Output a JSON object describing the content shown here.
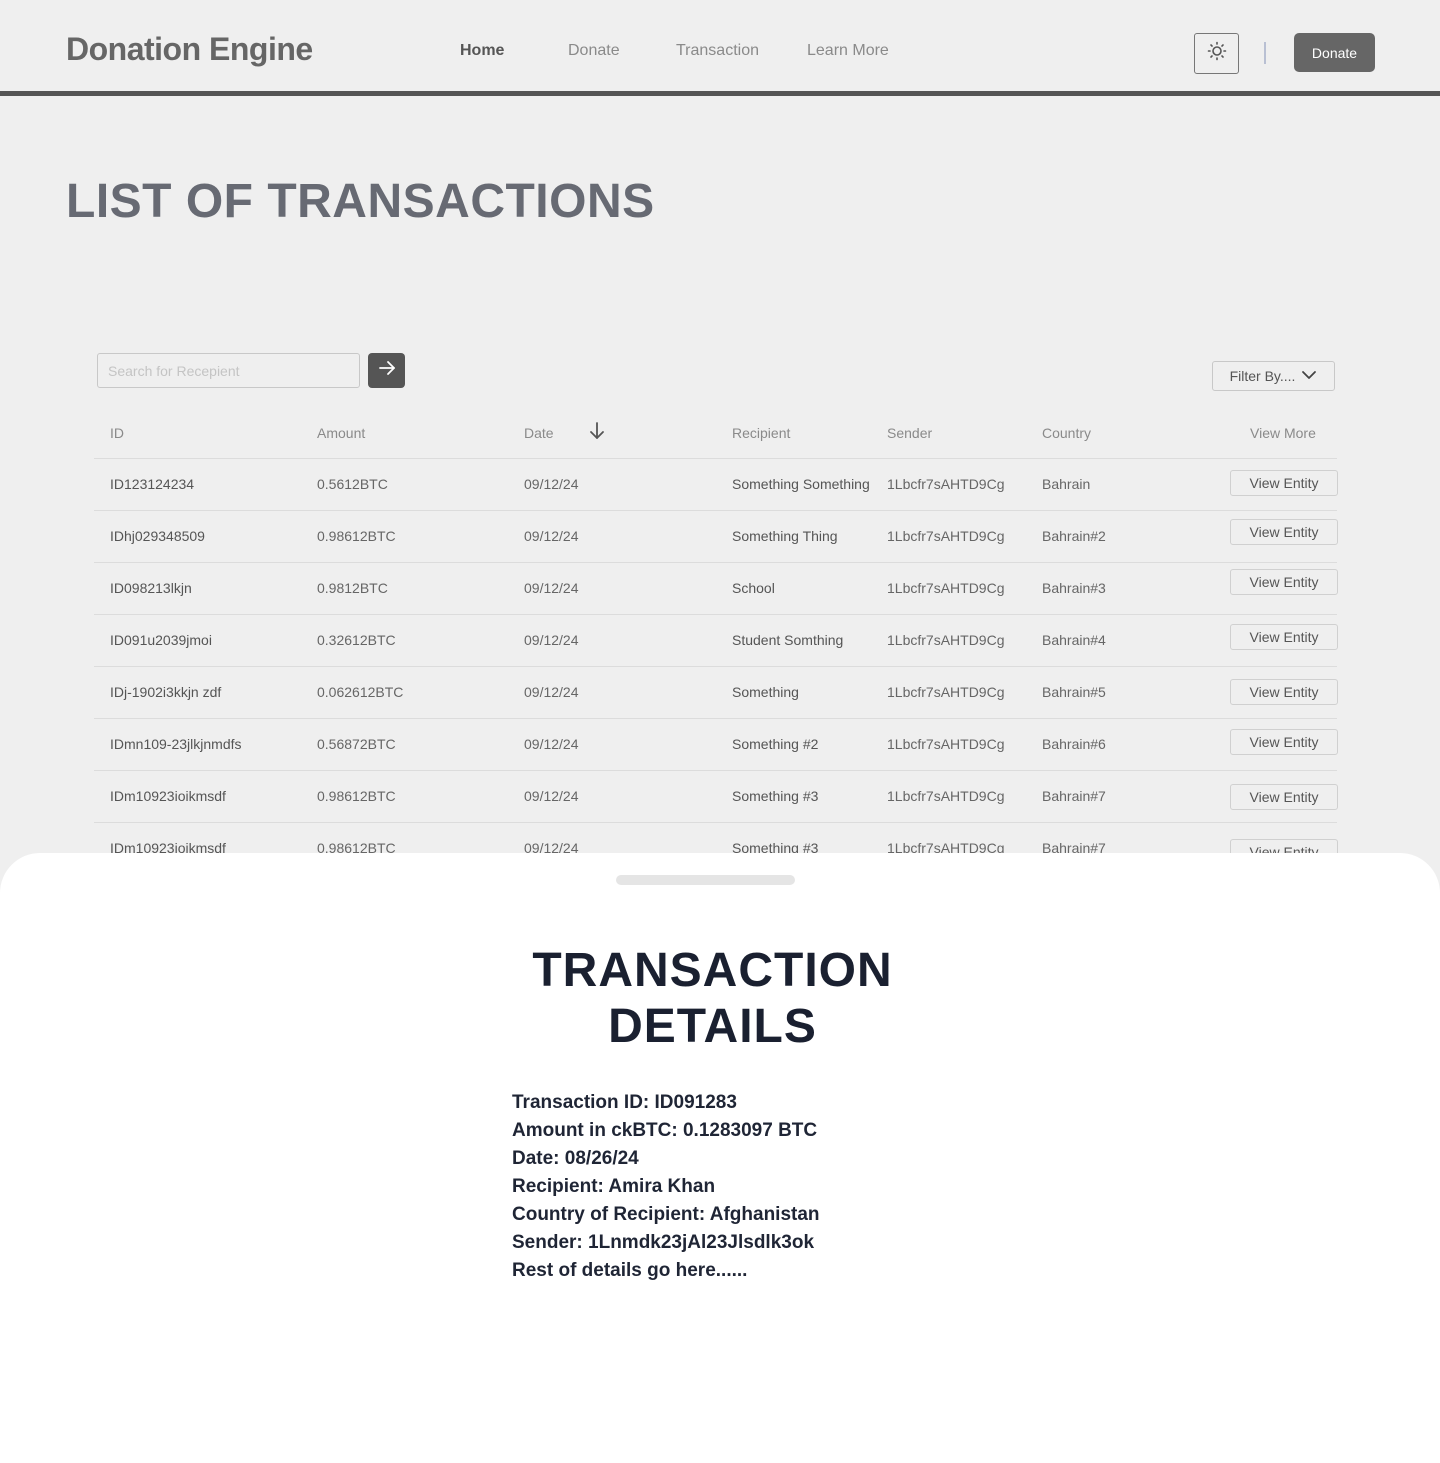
{
  "header": {
    "brand": "Donation Engine",
    "nav": [
      "Home",
      "Donate",
      "Transaction",
      "Learn More"
    ],
    "active_nav": "Home",
    "cta": "Donate",
    "theme_icon": "sun-icon"
  },
  "page": {
    "title": "LIST OF TRANSACTIONS"
  },
  "search": {
    "placeholder": "Search for Recepient",
    "value": ""
  },
  "filter": {
    "label": "Filter By...."
  },
  "table": {
    "headers": [
      "ID",
      "Amount",
      "Date",
      "Recipient",
      "Sender",
      "Country",
      "View More"
    ],
    "sort_icon": "arrow-down-icon",
    "rows": [
      {
        "id": "ID123124234",
        "amount": "0.5612BTC",
        "date": "09/12/24",
        "recipient": "Something Something",
        "sender": "1Lbcfr7sAHTD9Cg",
        "country": "Bahrain",
        "action": "View Entity"
      },
      {
        "id": "IDhj029348509",
        "amount": "0.98612BTC",
        "date": "09/12/24",
        "recipient": "Something Thing",
        "sender": "1Lbcfr7sAHTD9Cg",
        "country": "Bahrain#2",
        "action": "View Entity"
      },
      {
        "id": "ID098213lkjn",
        "amount": "0.9812BTC",
        "date": "09/12/24",
        "recipient": "School",
        "sender": "1Lbcfr7sAHTD9Cg",
        "country": "Bahrain#3",
        "action": "View Entity"
      },
      {
        "id": "ID091u2039jmoi",
        "amount": "0.32612BTC",
        "date": "09/12/24",
        "recipient": "Student Somthing",
        "sender": "1Lbcfr7sAHTD9Cg",
        "country": "Bahrain#4",
        "action": "View Entity"
      },
      {
        "id": "IDj-1902i3kkjn zdf",
        "amount": "0.062612BTC",
        "date": "09/12/24",
        "recipient": "Something",
        "sender": "1Lbcfr7sAHTD9Cg",
        "country": "Bahrain#5",
        "action": "View Entity"
      },
      {
        "id": "IDmn109-23jlkjnmdfs",
        "amount": "0.56872BTC",
        "date": "09/12/24",
        "recipient": "Something #2",
        "sender": "1Lbcfr7sAHTD9Cg",
        "country": "Bahrain#6",
        "action": "View Entity"
      },
      {
        "id": "IDm10923ioikmsdf",
        "amount": "0.98612BTC",
        "date": "09/12/24",
        "recipient": "Something #3",
        "sender": "1Lbcfr7sAHTD9Cg",
        "country": "Bahrain#7",
        "action": "View Entity"
      },
      {
        "id": "IDm10923ioikmsdf",
        "amount": "0.98612BTC",
        "date": "09/12/24",
        "recipient": "Something #3",
        "sender": "1Lbcfr7sAHTD9Cg",
        "country": "Bahrain#7",
        "action": "View Entity"
      }
    ]
  },
  "sheet": {
    "title_line1": "TRANSACTION",
    "title_line2": "DETAILS",
    "details": [
      "Transaction ID: ID091283",
      "Amount in ckBTC: 0.1283097 BTC",
      "Date: 08/26/24",
      "Recipient: Amira Khan",
      "Country of Recipient: Afghanistan",
      "Sender: 1Lnmdk23jAl23Jlsdlk3ok",
      "Rest of details go here......"
    ]
  }
}
